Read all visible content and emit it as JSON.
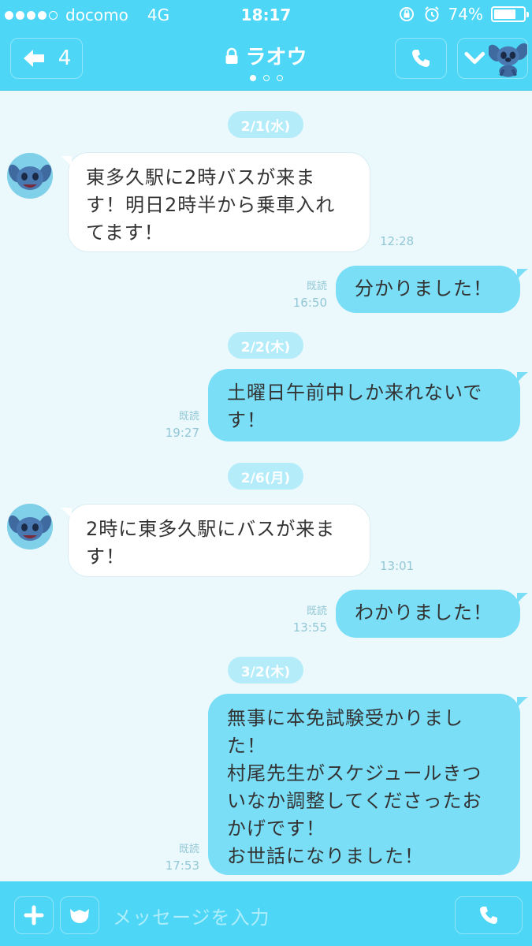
{
  "status_bar": {
    "carrier": "docomo",
    "network": "4G",
    "time": "18:17",
    "battery": "74%",
    "battery_level": 0.74
  },
  "header": {
    "back_count": "4",
    "title": "ラオウ",
    "page_dots": 3,
    "active_page": 0
  },
  "messages": [
    {
      "type": "date",
      "label": "2/1(水)"
    },
    {
      "type": "incoming",
      "lines": [
        "東多久駅に2時バスが来ま",
        "す！明日2時半から乗車入れ",
        "てます！"
      ],
      "time": "12:28"
    },
    {
      "type": "outgoing",
      "lines": [
        "分かりました！"
      ],
      "read": "既読",
      "time": "16:50"
    },
    {
      "type": "date",
      "label": "2/2(木)"
    },
    {
      "type": "outgoing",
      "lines": [
        "土曜日午前中しか来れないで",
        "す！"
      ],
      "read": "既読",
      "time": "19:27"
    },
    {
      "type": "date",
      "label": "2/6(月)"
    },
    {
      "type": "incoming",
      "lines": [
        "2時に東多久駅にバスが来ま",
        "す！"
      ],
      "time": "13:01"
    },
    {
      "type": "outgoing",
      "lines": [
        "わかりました！"
      ],
      "read": "既読",
      "time": "13:55"
    },
    {
      "type": "date",
      "label": "3/2(木)"
    },
    {
      "type": "outgoing",
      "lines": [
        "無事に本免試験受かりまし",
        "た！",
        "村尾先生がスケジュールきつ",
        "いなか調整してくださったお",
        "かげです！",
        "お世話になりました！"
      ],
      "read": "既読",
      "time": "17:53"
    }
  ],
  "input_bar": {
    "placeholder": "メッセージを入力"
  },
  "colors": {
    "header": "#4dd6f5",
    "chat_background": "#ebf9fd",
    "outgoing_bubble": "#7adef7",
    "incoming_bubble": "#ffffff",
    "date_pill": "#b5ecfa"
  },
  "icons": [
    "back-arrow-icon",
    "lock-icon",
    "phone-icon",
    "chevron-down-icon",
    "plus-icon",
    "sticker-icon",
    "alarm-icon",
    "rotation-lock-icon"
  ]
}
